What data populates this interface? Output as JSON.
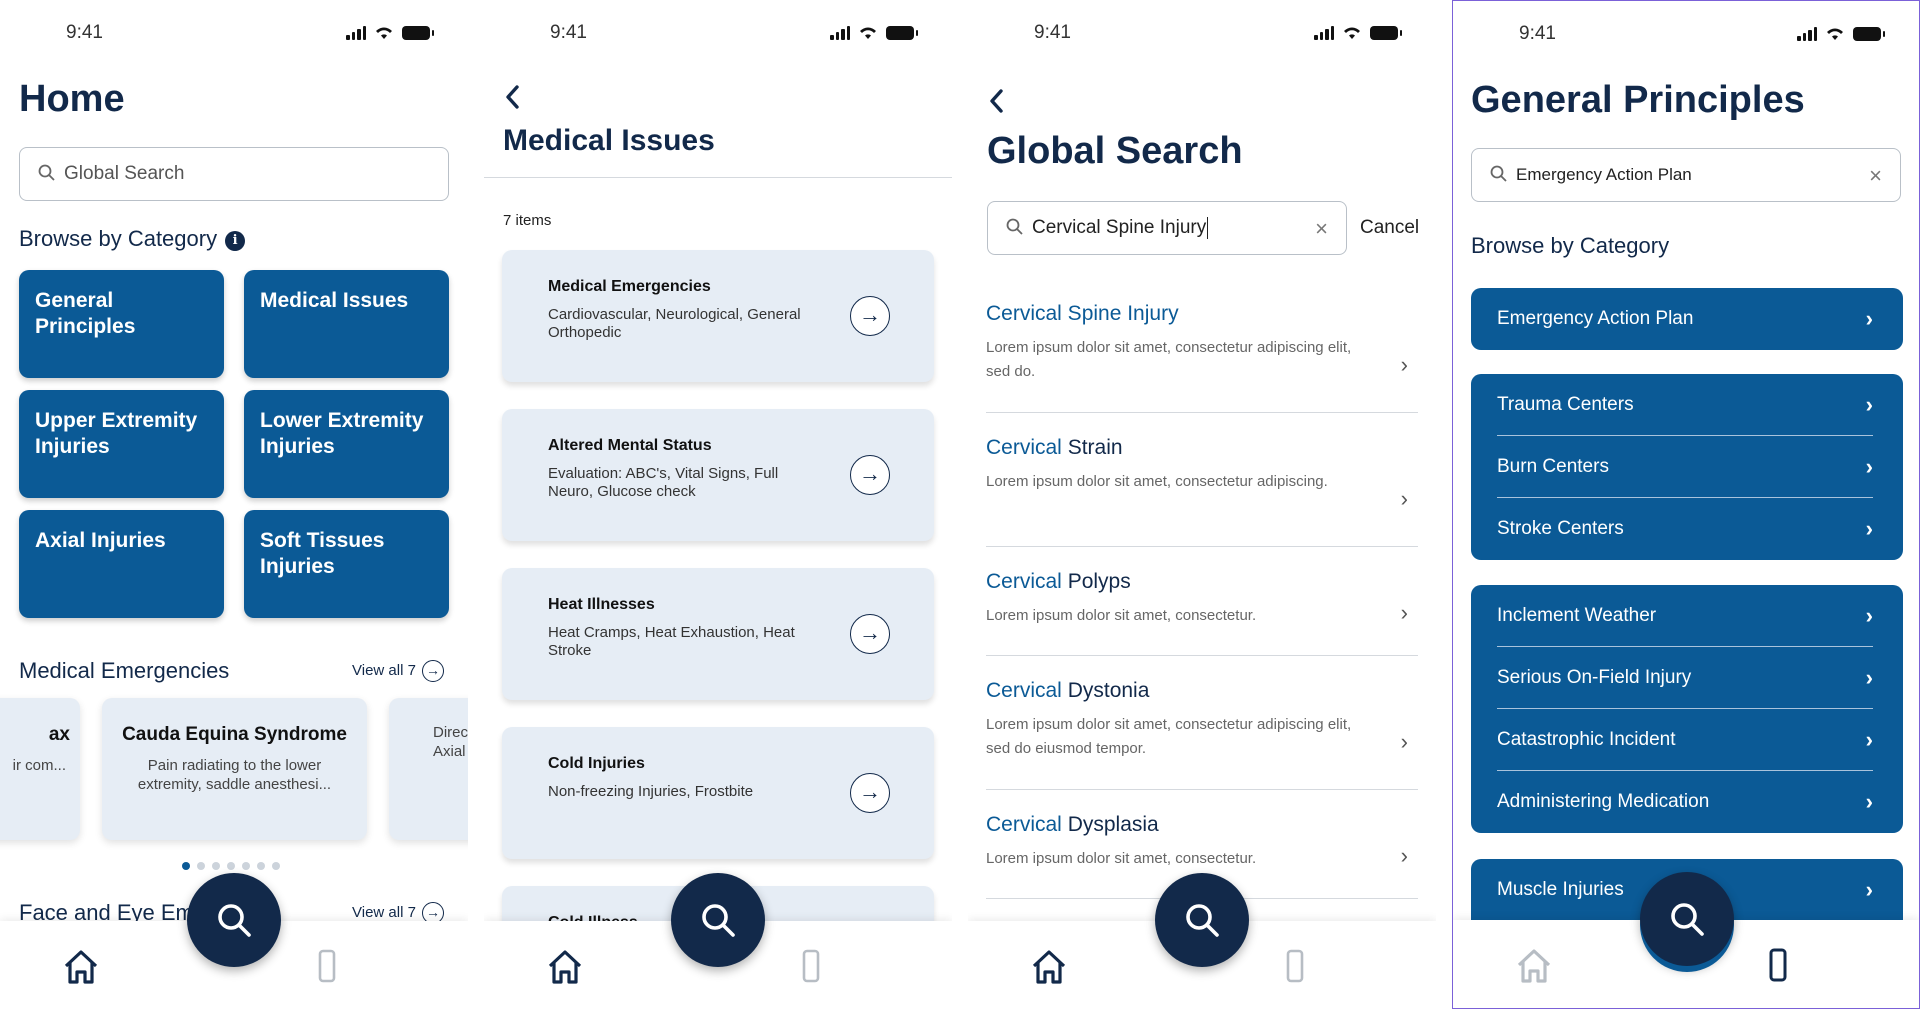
{
  "status": {
    "time": "9:41"
  },
  "screen1": {
    "title": "Home",
    "search_placeholder": "Global Search",
    "browse_heading": "Browse by Category",
    "categories": [
      "General Principles",
      "Medical Issues",
      "Upper Extremity Injuries",
      "Lower Extremity Injuries",
      "Axial Injuries",
      "Soft Tissues Injuries"
    ],
    "emergencies_heading": "Medical Emergencies",
    "view_all": "View all 7",
    "cards": [
      {
        "title": "ax",
        "desc": "ir com..."
      },
      {
        "title": "Cauda Equina Syndrome",
        "desc": "Pain radiating to the lower extremity, saddle anesthesi..."
      },
      {
        "title": "",
        "desc": "Direc Axial I"
      }
    ],
    "next_heading": "Face and Eye Eme",
    "next_view_all": "View all 7"
  },
  "screen2": {
    "title": "Medical Issues",
    "count": "7 items",
    "items": [
      {
        "title": "Medical Emergencies",
        "desc": "Cardiovascular, Neurological, General Orthopedic"
      },
      {
        "title": "Altered Mental Status",
        "desc": "Evaluation: ABC's, Vital Signs, Full Neuro, Glucose check"
      },
      {
        "title": "Heat Illnesses",
        "desc": "Heat Cramps, Heat Exhaustion, Heat Stroke"
      },
      {
        "title": "Cold Injuries",
        "desc": "Non-freezing Injuries, Frostbite"
      },
      {
        "title": "Cold Illness",
        "desc": ""
      }
    ]
  },
  "screen3": {
    "title": "Global Search",
    "search_value": "Cervical Spine Injury",
    "cancel": "Cancel",
    "results": [
      {
        "match": "Cervical Spine Injury",
        "rest": "",
        "desc": "Lorem ipsum dolor sit amet, consectetur adipiscing elit, sed do."
      },
      {
        "match": "Cervical",
        "rest": " Strain",
        "desc": "Lorem ipsum dolor sit amet, consectetur adipiscing."
      },
      {
        "match": "Cervical",
        "rest": " Polyps",
        "desc": "Lorem ipsum dolor sit amet, consectetur."
      },
      {
        "match": "Cervical",
        "rest": " Dystonia",
        "desc": "Lorem ipsum dolor sit amet, consectetur adipiscing elit, sed do eiusmod tempor."
      },
      {
        "match": "Cervical",
        "rest": " Dysplasia",
        "desc": "Lorem ipsum dolor sit amet, consectetur."
      }
    ]
  },
  "screen4": {
    "title": "General Principles",
    "search_value": "Emergency Action Plan",
    "browse_heading": "Browse by Category",
    "groups": [
      [
        "Emergency Action Plan"
      ],
      [
        "Trauma Centers",
        "Burn Centers",
        "Stroke Centers"
      ],
      [
        "Inclement Weather",
        "Serious On-Field Injury",
        "Catastrophic Incident",
        "Administering Medication"
      ],
      [
        "Muscle Injuries"
      ]
    ]
  },
  "colors": {
    "navy": "#12294a",
    "blue": "#0b5a96",
    "card": "#e6edf5"
  }
}
